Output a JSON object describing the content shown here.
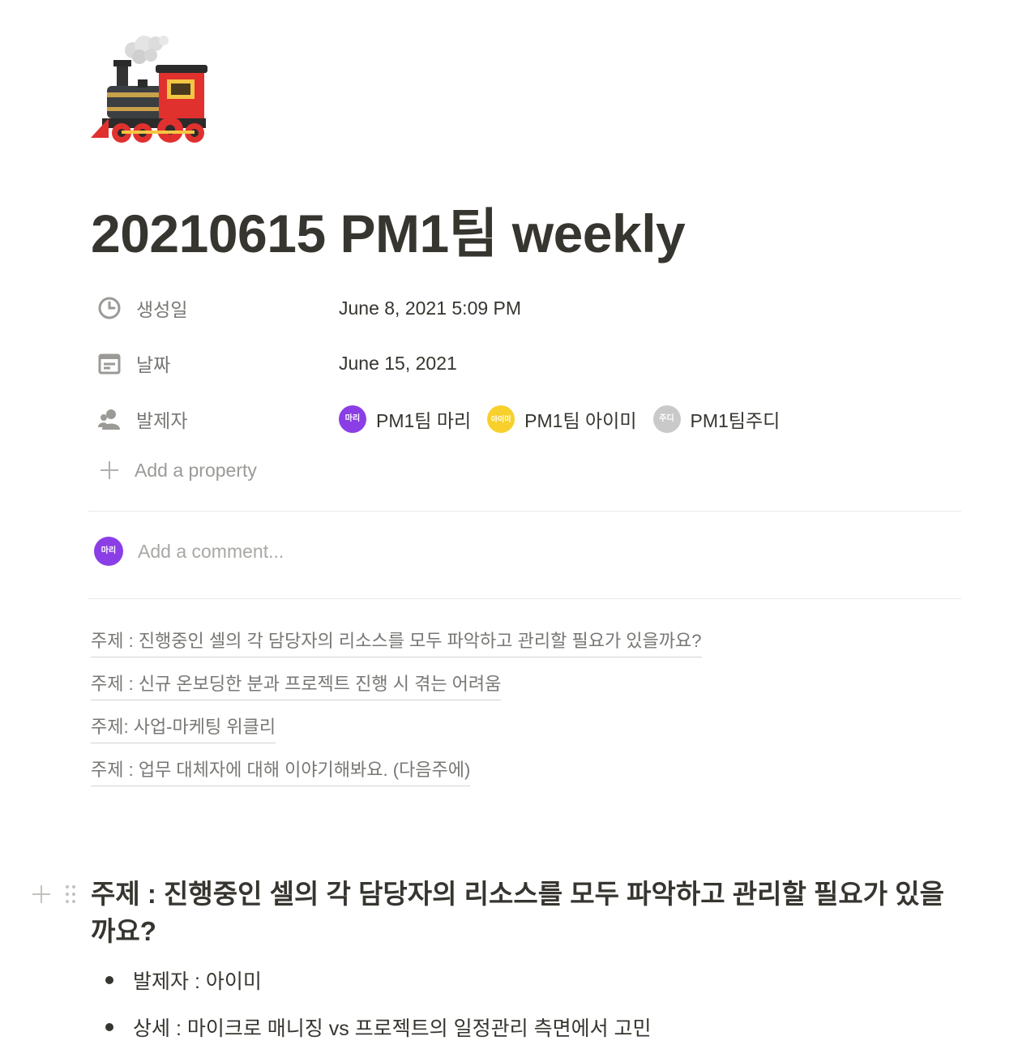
{
  "page": {
    "icon": "steam-locomotive-icon",
    "title": "20210615 PM1팀 weekly"
  },
  "properties": [
    {
      "icon": "clock-icon",
      "label": "생성일",
      "value": "June 8, 2021 5:09 PM"
    },
    {
      "icon": "calendar-icon",
      "label": "날짜",
      "value": "June 15, 2021"
    },
    {
      "icon": "people-icon",
      "label": "발제자"
    }
  ],
  "people": [
    {
      "name": "PM1팀 마리",
      "avatar_text": "마리",
      "avatar_color": "#8b3ee6"
    },
    {
      "name": "PM1팀 아이미",
      "avatar_text": "아이미",
      "avatar_color": "#f7d02c"
    },
    {
      "name": "PM1팀주디",
      "avatar_text": "주디",
      "avatar_color": "#c9c9c9"
    }
  ],
  "add_property": {
    "label": "Add a property"
  },
  "comment": {
    "placeholder": "Add a comment...",
    "avatar_text": "마리"
  },
  "toc": [
    "주제 : 진행중인 셀의 각 담당자의 리소스를 모두 파악하고 관리할 필요가 있을까요?",
    "주제 : 신규 온보딩한 분과 프로젝트 진행 시 겪는 어려움",
    "주제: 사업-마케팅 위클리",
    "주제 : 업무 대체자에 대해 이야기해봐요. (다음주에)"
  ],
  "section": {
    "heading": "주제 : 진행중인 셀의 각 담당자의 리소스를 모두 파악하고 관리할 필요가 있을까요?",
    "bullets": [
      "발제자 : 아이미",
      "상세 : 마이크로 매니징 vs 프로젝트의 일정관리 측면에서 고민"
    ]
  },
  "colors": {
    "text": "#37352f",
    "muted": "#787774",
    "placeholder": "#9b9a97",
    "divider": "#e9e9e7"
  }
}
